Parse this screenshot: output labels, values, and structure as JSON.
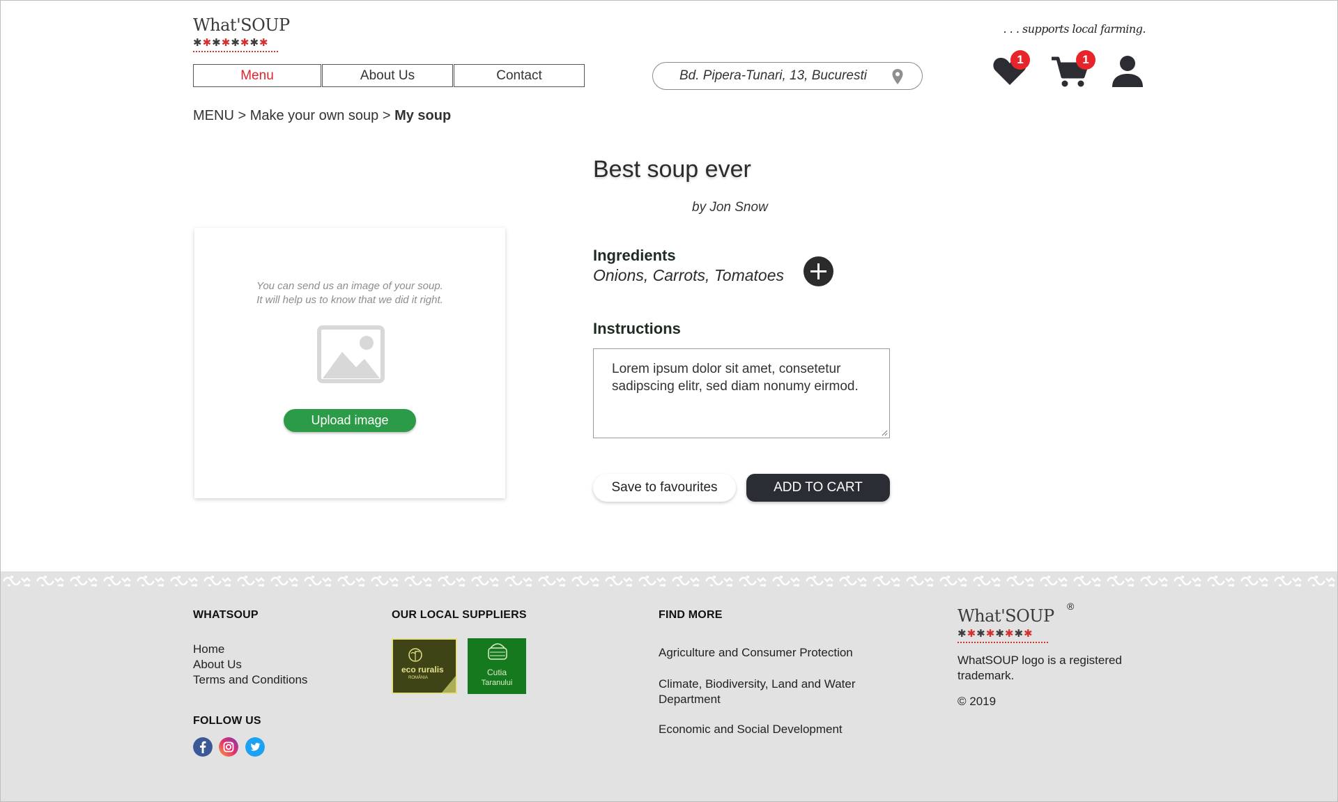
{
  "header": {
    "logo_text": "What'SOUP",
    "tagline": ". . . supports local farming.",
    "nav": [
      {
        "label": "Menu",
        "active": true
      },
      {
        "label": "About Us",
        "active": false
      },
      {
        "label": "Contact",
        "active": false
      }
    ],
    "address": "Bd. Pipera-Tunari, 13, Bucuresti",
    "favourites_count": "1",
    "cart_count": "1"
  },
  "breadcrumb": {
    "root": "MENU",
    "sep1": ">",
    "middle": "Make your own soup",
    "sep2": ">",
    "current": "My soup"
  },
  "upload": {
    "hint_line1": "You can send us an image of your soup.",
    "hint_line2": "It will help us to know that we did it right.",
    "button_label": "Upload image"
  },
  "soup": {
    "title": "Best soup ever",
    "author": "by Jon Snow",
    "ingredients_label": "Ingredients",
    "ingredients": "Onions, Carrots, Tomatoes",
    "instructions_label": "Instructions",
    "instructions": "Lorem ipsum dolor sit amet, consetetur sadipscing elitr, sed diam nonumy eirmod.",
    "save_button": "Save to favourites",
    "cart_button": "ADD TO CART"
  },
  "footer": {
    "col1_title": "WHATSOUP",
    "col1_links": [
      "Home",
      "About Us",
      "Terms and Conditions"
    ],
    "follow_title": "FOLLOW US",
    "col2_title": "OUR LOCAL SUPPLIERS",
    "suppliers": [
      {
        "line1": "eco ruralis",
        "line2": "ROMÂNIA"
      },
      {
        "line1": "Cutia",
        "line2": "Taranului"
      }
    ],
    "col3_title": "FIND MORE",
    "col3_links": [
      "Agriculture and Consumer Protection",
      "Climate, Biodiversity, Land and Water Department",
      "Economic and Social Development"
    ],
    "logo_text": "What'SOUP",
    "registered": "®",
    "trademark": "WhatSOUP logo is a registered trademark.",
    "copyright": "© 2019"
  },
  "colors": {
    "accent_red": "#e0242b",
    "upload_green": "#2b9b48",
    "cart_dark": "#2a2d33",
    "footer_bg": "#e2e2e2"
  }
}
